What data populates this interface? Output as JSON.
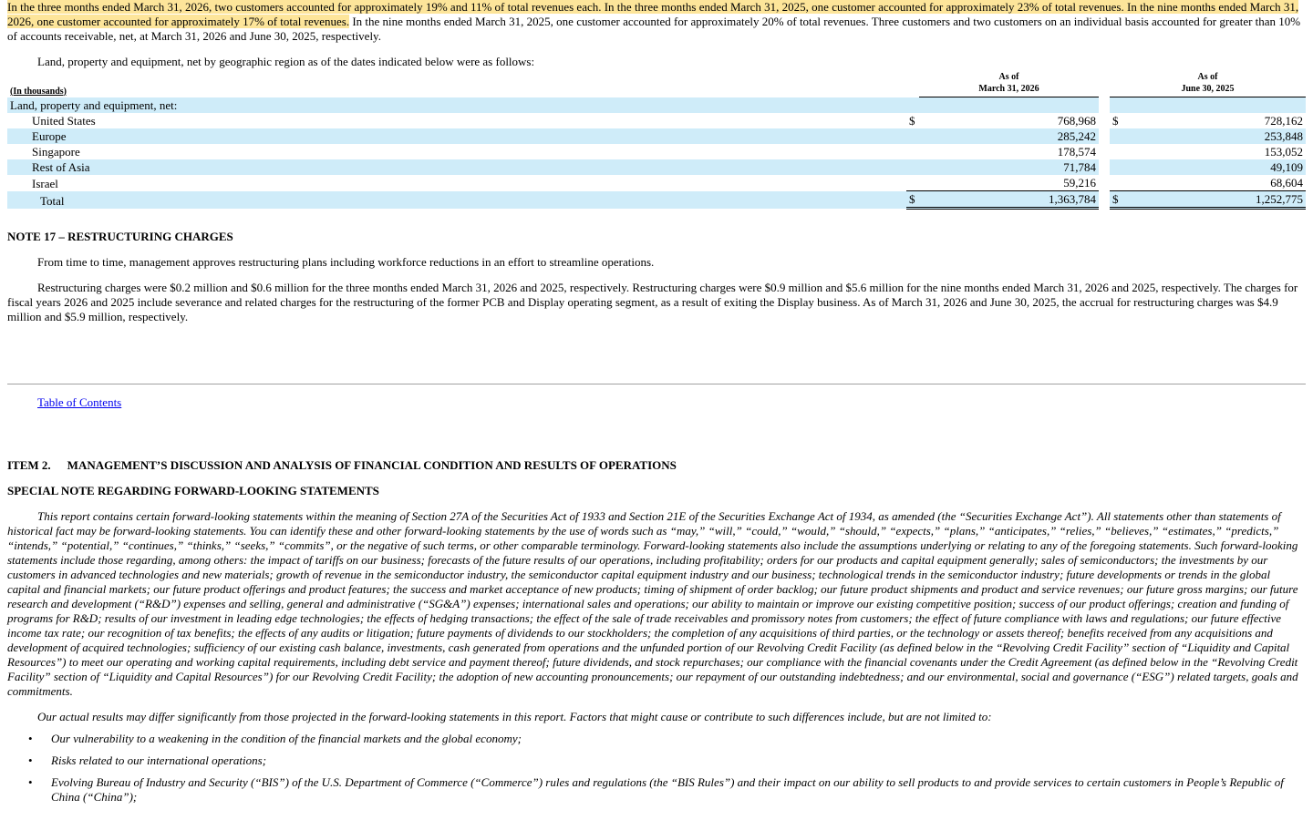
{
  "intro": {
    "highlighted": "In the three months ended March 31, 2026, two customers accounted for approximately 19% and 11% of total revenues each. In the three months ended March 31, 2025, one customer accounted for approximately 23% of total revenues. In the nine months ended March 31, 2026, one customer accounted for approximately 17% of total revenues.",
    "rest": " In the nine months ended March 31, 2025, one customer accounted for approximately 20% of total revenues. Three customers and two customers on an individual basis accounted for greater than 10% of accounts receivable, net, at March 31, 2026 and June 30, 2025, respectively."
  },
  "geo_intro": "Land, property and equipment, net by geographic region as of the dates indicated below were as follows:",
  "geo_table": {
    "unit_label": "(In thousands)",
    "col1_line1": "As of",
    "col1_line2": "March 31, 2026",
    "col2_line1": "As of",
    "col2_line2": "June 30, 2025",
    "section_label": "Land, property and equipment, net:",
    "currency": "$",
    "rows": [
      {
        "label": "United States",
        "v1": "768,968",
        "v2": "728,162"
      },
      {
        "label": "Europe",
        "v1": "285,242",
        "v2": "253,848"
      },
      {
        "label": "Singapore",
        "v1": "178,574",
        "v2": "153,052"
      },
      {
        "label": "Rest of Asia",
        "v1": "71,784",
        "v2": "49,109"
      },
      {
        "label": "Israel",
        "v1": "59,216",
        "v2": "68,604"
      }
    ],
    "total": {
      "label": "Total",
      "v1": "1,363,784",
      "v2": "1,252,775"
    }
  },
  "note17": {
    "title": "NOTE 17 – RESTRUCTURING CHARGES",
    "para1": "From time to time, management approves restructuring plans including workforce reductions in an effort to streamline operations.",
    "para2": "Restructuring charges were $0.2 million and $0.6 million for the three months ended March 31, 2026 and 2025, respectively. Restructuring charges were $0.9 million and $5.6 million for the nine months ended March 31, 2026 and 2025, respectively. The charges for fiscal years 2026 and 2025 include severance and related charges for the restructuring of the former PCB and Display operating segment, as a result of exiting the Display business. As of March 31, 2026 and June 30, 2025, the accrual for restructuring charges was $4.9 million and $5.9 million, respectively."
  },
  "toc_link": "Table of Contents",
  "item2": {
    "number": "ITEM 2.",
    "title": "MANAGEMENT’S DISCUSSION AND ANALYSIS OF FINANCIAL CONDITION AND RESULTS OF OPERATIONS"
  },
  "special_note_title": "SPECIAL NOTE REGARDING FORWARD-LOOKING STATEMENTS",
  "forward_para": "This report contains certain forward-looking statements within the meaning of Section 27A of the Securities Act of 1933 and Section 21E of the Securities Exchange Act of 1934, as amended (the “Securities Exchange Act”). All statements other than statements of historical fact may be forward-looking statements. You can identify these and other forward-looking statements by the use of words such as “may,” “will,” “could,” “would,” “should,” “expects,” “plans,” “anticipates,” “relies,” “believes,” “estimates,” “predicts,” “intends,” “potential,” “continues,” “thinks,” “seeks,” “commits”, or the negative of such terms, or other comparable terminology. Forward-looking statements also include the assumptions underlying or relating to any of the foregoing statements. Such forward-looking statements include those regarding, among others: the impact of tariffs on our business; forecasts of the future results of our operations, including profitability; orders for our products and capital equipment generally; sales of semiconductors; the investments by our customers in advanced technologies and new materials; growth of revenue in the semiconductor industry, the semiconductor capital equipment industry and our business; technological trends in the semiconductor industry; future developments or trends in the global capital and financial markets; our future product offerings and product features; the success and market acceptance of new products; timing of shipment of order backlog; our future product shipments and product and service revenues; our future gross margins; our future research and development (“R&D”) expenses and selling, general and administrative (“SG&A”) expenses; international sales and operations; our ability to maintain or improve our existing competitive position; success of our product offerings; creation and funding of programs for R&D; results of our investment in leading edge technologies; the effects of hedging transactions; the effect of the sale of trade receivables and promissory notes from customers; the effect of future compliance with laws and regulations; our future effective income tax rate; our recognition of tax benefits; the effects of any audits or litigation; future payments of dividends to our stockholders; the completion of any acquisitions of third parties, or the technology or assets thereof; benefits received from any acquisitions and development of acquired technologies; sufficiency of our existing cash balance, investments, cash generated from operations and the unfunded portion of our Revolving Credit Facility (as defined below in the “Revolving Credit Facility” section of “Liquidity and Capital Resources”) to meet our operating and working capital requirements, including debt service and payment thereof; future dividends, and stock repurchases; our compliance with the financial covenants under the Credit Agreement (as defined below in the “Revolving Credit Facility” section of “Liquidity and Capital Resources”) for our Revolving Credit Facility; the adoption of new accounting pronouncements; our repayment of our outstanding indebtedness; and our environmental, social and governance (“ESG”) related targets, goals and commitments.",
  "results_para": "Our actual results may differ significantly from those projected in the forward-looking statements in this report. Factors that might cause or contribute to such differences include, but are not limited to:",
  "bullet_char": "•",
  "bullets": [
    "Our vulnerability to a weakening in the condition of the financial markets and the global economy;",
    "Risks related to our international operations;",
    "Evolving Bureau of Industry and Security (“BIS”) of the U.S. Department of Commerce (“Commerce”) rules and regulations (the “BIS Rules”) and their impact on our ability to sell products to and provide services to certain customers in People’s Republic of China (“China”);"
  ],
  "colors": {
    "highlight": "#fde59a",
    "table_shade": "#cfecf9",
    "link": "#0000ee",
    "rule": "#a0a0a0"
  }
}
